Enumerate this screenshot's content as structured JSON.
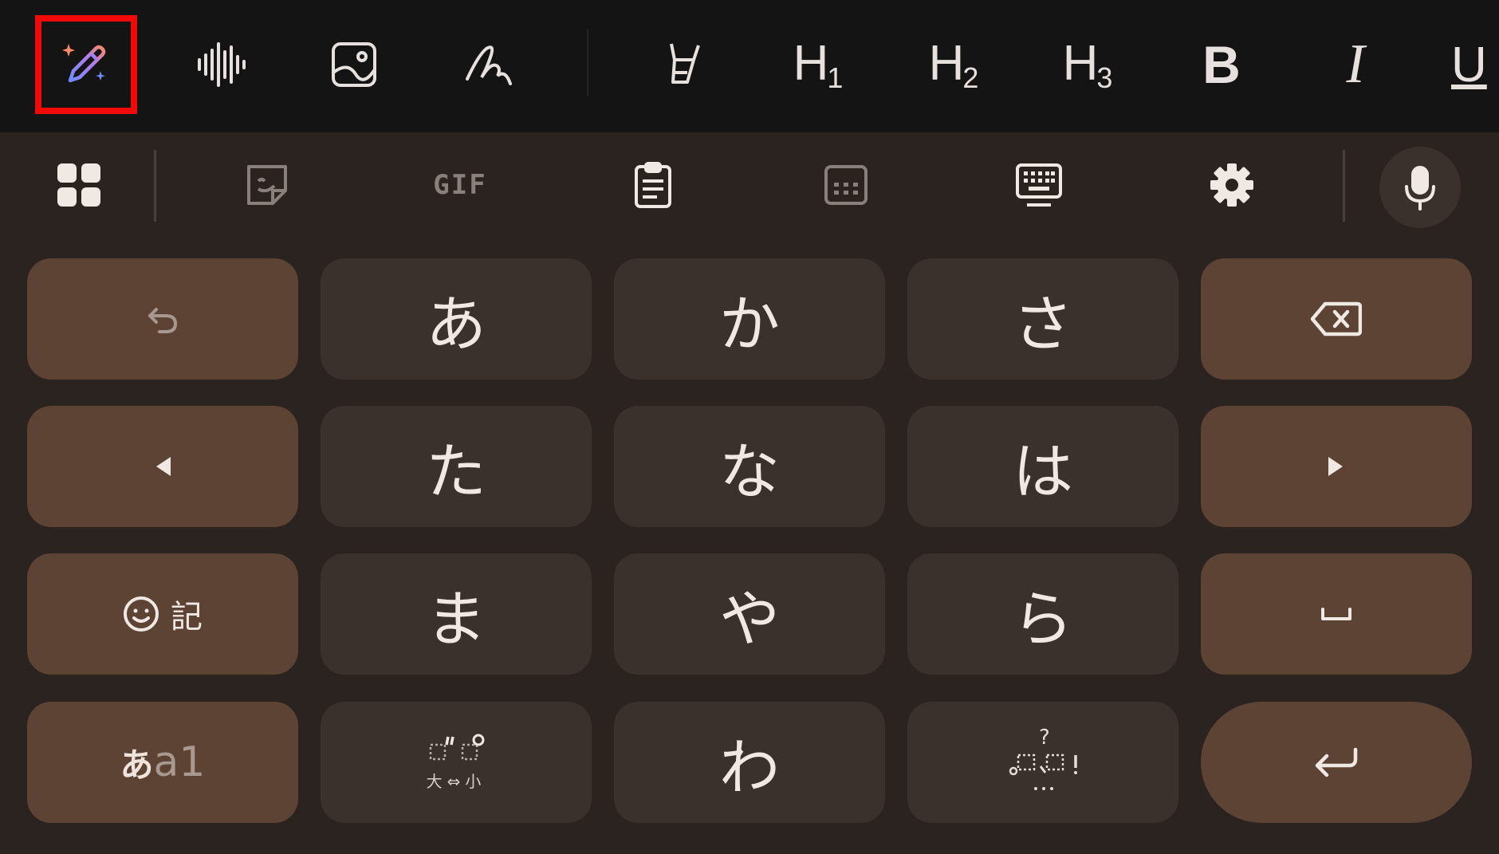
{
  "format_toolbar": {
    "h1": {
      "main": "H",
      "sub": "1"
    },
    "h2": {
      "main": "H",
      "sub": "2"
    },
    "h3": {
      "main": "H",
      "sub": "3"
    },
    "bold": "B",
    "italic": "I",
    "underline": "U"
  },
  "tool_row": {
    "gif": "GIF"
  },
  "keys": {
    "row1": [
      "あ",
      "か",
      "さ"
    ],
    "row2": [
      "た",
      "な",
      "は"
    ],
    "row3": [
      "ま",
      "や",
      "ら"
    ],
    "row4_center": "わ",
    "symbols": "記",
    "mode_a": "あ",
    "mode_b": "a1",
    "dakuten_label": "大⇔小"
  },
  "icons": {
    "ai_write": "pencil-sparkle-icon",
    "voice_wave": "waveform-icon",
    "image": "image-icon",
    "handwriting": "handwriting-icon",
    "highlighter": "highlighter-icon",
    "menu": "grid-menu-icon",
    "sticker": "sticker-icon",
    "clipboard": "clipboard-icon",
    "numpad": "numpad-icon",
    "keyboard": "keyboard-icon",
    "settings": "gear-icon",
    "mic": "microphone-icon"
  },
  "colors": {
    "highlight": "#f20a0a",
    "fn_key": "#5c4334",
    "char_key": "#3a302c",
    "toolbar_bg": "#151414",
    "keyboard_bg": "#2b2320"
  }
}
